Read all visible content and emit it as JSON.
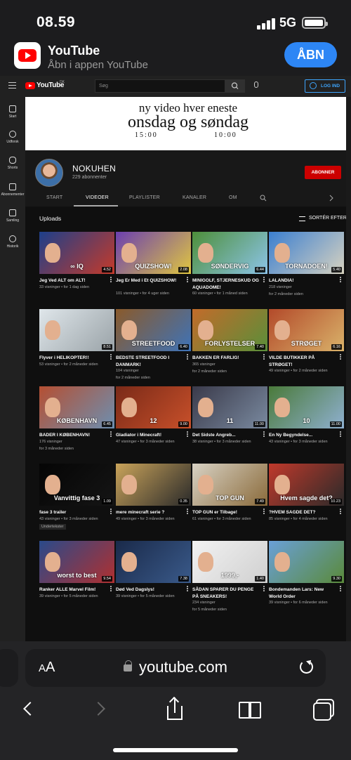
{
  "status": {
    "time": "08.59",
    "network": "5G"
  },
  "app_banner": {
    "title": "YouTube",
    "subtitle": "Åbn i appen YouTube",
    "open_label": "ÅBN"
  },
  "yt_header": {
    "logo_text": "YouTube",
    "country": "DK",
    "search_placeholder": "Søg",
    "login_label": "LOG IND"
  },
  "left_nav": [
    {
      "label": "Start",
      "icon": "home-icon"
    },
    {
      "label": "Udforsk",
      "icon": "compass-icon"
    },
    {
      "label": "Shorts",
      "icon": "shorts-icon"
    },
    {
      "label": "Abonnementer",
      "icon": "subscriptions-icon"
    },
    {
      "label": "Samling",
      "icon": "library-icon"
    },
    {
      "label": "Historik",
      "icon": "history-icon"
    }
  ],
  "channel_banner": {
    "line1": "ny video hver eneste",
    "line2": "onsdag og søndag",
    "time1": "15:00",
    "time2": "10:00"
  },
  "channel": {
    "name": "NOKUHEN",
    "subscribers": "229 abonnenter",
    "subscribe_label": "ABONNER"
  },
  "tabs": [
    "START",
    "VIDEOER",
    "PLAYLISTER",
    "KANALER",
    "OM"
  ],
  "active_tab": "VIDEOER",
  "section": {
    "title": "Uploads",
    "sort_label": "SORTÉR EFTER"
  },
  "videos": [
    {
      "title": "Jeg Ved ALT om ALT!",
      "meta1": "33 visninger • for 1 dag siden",
      "meta2": "",
      "duration": "4.52",
      "thumb_text": "∞ IQ",
      "c1": "#1d3f8a",
      "c2": "#c53a2a"
    },
    {
      "title": "Jeg Er Med i Et QUIZSHOW!",
      "meta1": "101 visninger • for 4 uger siden",
      "meta2": "",
      "duration": "2.08",
      "thumb_text": "QUIZSHOW!",
      "c1": "#6b3fb0",
      "c2": "#e0c640"
    },
    {
      "title": "MINIGOLF, STJERNESKUD OG AQUADOME!",
      "meta1": "60 visninger • for 1 måned siden",
      "meta2": "",
      "duration": "6.44",
      "thumb_text": "SØNDERVIG",
      "c1": "#4d8f3a",
      "c2": "#8cc4e8"
    },
    {
      "title": "LALANDIA!",
      "meta1": "218 visninger",
      "meta2": "for 2 måneder siden",
      "duration": "5.40",
      "thumb_text": "TORNADOEN!",
      "c1": "#3b7fd0",
      "c2": "#d7d2c0"
    },
    {
      "title": "Flyver i HELIKOPTER!!",
      "meta1": "53 visninger • for 2 måneder siden",
      "meta2": "",
      "duration": "8.51",
      "thumb_text": "",
      "c1": "#dfe6ea",
      "c2": "#9aa3a8"
    },
    {
      "title": "BEDSTE STREETFOOD I DANMARK!",
      "meta1": "104 visninger",
      "meta2": "for 2 måneder siden",
      "duration": "6.40",
      "thumb_text": "STREETFOOD",
      "c1": "#8a5a2b",
      "c2": "#3e73b8"
    },
    {
      "title": "BAKKEN ER FARLIG!",
      "meta1": "365 visninger",
      "meta2": "for 2 måneder siden",
      "duration": "7.40",
      "thumb_text": "FORLYSTELSER",
      "c1": "#c26b2a",
      "c2": "#5a8f3a"
    },
    {
      "title": "VILDE BUTIKKER PÅ STRØGET!",
      "meta1": "49 visninger • for 2 måneder siden",
      "meta2": "",
      "duration": "6.16",
      "thumb_text": "STRØGET",
      "c1": "#b34a2a",
      "c2": "#d9b26a"
    },
    {
      "title": "BADER I KØBENHAVN!",
      "meta1": "176 visninger",
      "meta2": "for 3 måneder siden",
      "duration": "6.45",
      "thumb_text": "KØBENHAVN",
      "c1": "#b54f32",
      "c2": "#6d8fb0"
    },
    {
      "title": "Gladiator i Minecraft!",
      "meta1": "47 visninger • for 3 måneder siden",
      "meta2": "",
      "duration": "9.00",
      "thumb_text": "12",
      "c1": "#7a2a18",
      "c2": "#c8502a"
    },
    {
      "title": "Det Sidste Angreb...",
      "meta1": "38 visninger • for 3 måneder siden",
      "meta2": "",
      "duration": "11.00",
      "thumb_text": "11",
      "c1": "#3a3a4a",
      "c2": "#7a8aa0"
    },
    {
      "title": "En Ny Begyndelse...",
      "meta1": "43 visninger • for 3 måneder siden",
      "meta2": "",
      "duration": "11.00",
      "thumb_text": "10",
      "c1": "#4a7a3a",
      "c2": "#8fb0d0"
    },
    {
      "title": "fase 3 trailer",
      "meta1": "43 visninger • for 3 måneder siden",
      "meta2": "",
      "duration": "1.09",
      "thumb_text": "Vanvittig fase 3",
      "c1": "#050505",
      "c2": "#151515",
      "badge": "Undertekster"
    },
    {
      "title": "mere minecraft serie ?",
      "meta1": "49 visninger • for 3 måneder siden",
      "meta2": "",
      "duration": "0.35",
      "thumb_text": "",
      "c1": "#c9a35a",
      "c2": "#2a2a2a"
    },
    {
      "title": "TOP GUN er Tilbage!",
      "meta1": "61 visninger • for 3 måneder siden",
      "meta2": "",
      "duration": "7.49",
      "thumb_text": "TOP GUN",
      "c1": "#d8d2c4",
      "c2": "#8a6a3a"
    },
    {
      "title": "?HVEM SAGDE DET?",
      "meta1": "85 visninger • for 4 måneder siden",
      "meta2": "",
      "duration": "10.23",
      "thumb_text": "Hvem sagde det?",
      "c1": "#c0392b",
      "c2": "#2a2a2a"
    },
    {
      "title": "Ranker ALLE Marvel Film!",
      "meta1": "39 visninger • for 5 måneder siden",
      "meta2": "",
      "duration": "9.54",
      "thumb_text": "worst to best",
      "c1": "#2a4a8a",
      "c2": "#b03030"
    },
    {
      "title": "Død Ved Dagslys!",
      "meta1": "39 visninger • for 5 måneder siden",
      "meta2": "",
      "duration": "7.38",
      "thumb_text": "",
      "c1": "#1a2a4a",
      "c2": "#3a5a8a"
    },
    {
      "title": "SÅDAN SPARER DU PENGE PÅ SNEAKERS!",
      "meta1": "234 visninger",
      "meta2": "for 5 måneder siden",
      "duration": "1.40",
      "thumb_text": "1999,-",
      "c1": "#f2f2f2",
      "c2": "#d0d0d0"
    },
    {
      "title": "Bondemanden Lars: New World Order",
      "meta1": "39 visninger • for 6 måneder siden",
      "meta2": "",
      "duration": "9.30",
      "thumb_text": "",
      "c1": "#6aa0d8",
      "c2": "#5a8a3a"
    }
  ],
  "safari": {
    "aa_label": "AA",
    "url": "youtube.com"
  },
  "colors": {
    "accent_blue": "#2d86f5",
    "youtube_red": "#ff0000",
    "subscribe_red": "#cc0000"
  }
}
